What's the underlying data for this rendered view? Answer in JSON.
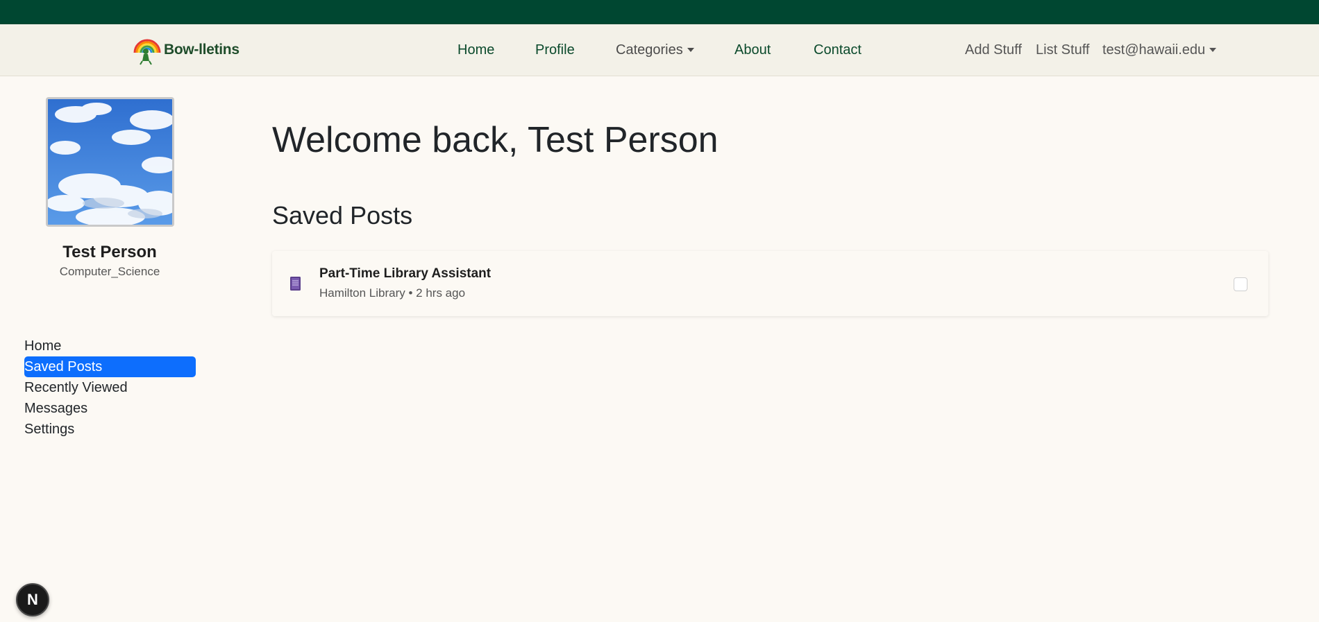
{
  "brand": {
    "name": "Bow-lletins",
    "logo_icon": "rainbow-mascot-icon"
  },
  "nav": {
    "center": [
      "Home",
      "Profile",
      "Categories",
      "About",
      "Contact"
    ],
    "right": {
      "add": "Add Stuff",
      "list": "List Stuff",
      "user": "test@hawaii.edu"
    }
  },
  "profile": {
    "name": "Test Person",
    "department": "Computer_Science",
    "avatar_icon": "sky-clouds-image"
  },
  "sidebar": {
    "items": [
      {
        "label": "Home",
        "active": false
      },
      {
        "label": "Saved Posts",
        "active": true
      },
      {
        "label": "Recently Viewed",
        "active": false
      },
      {
        "label": "Messages",
        "active": false
      },
      {
        "label": "Settings",
        "active": false
      }
    ]
  },
  "main": {
    "welcome": "Welcome back, Test Person",
    "section_title": "Saved Posts",
    "posts": [
      {
        "title": "Part-Time Library Assistant",
        "meta": "Hamilton Library • 2 hrs ago",
        "icon": "book-icon",
        "checked": false
      }
    ]
  },
  "badge": {
    "label": "N",
    "icon": "nextjs-dev-indicator-icon"
  },
  "colors": {
    "topbar": "#004731",
    "navbar": "#f3f1e8",
    "background": "#fcf9f4",
    "active": "#0d6efd",
    "nav_text": "#0b4a2c"
  }
}
